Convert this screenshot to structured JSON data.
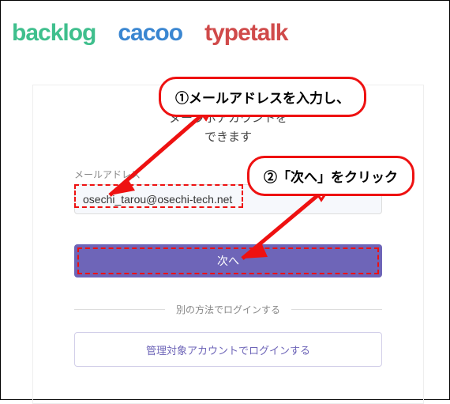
{
  "logos": {
    "backlog": "backlog",
    "cacoo": "cacoo",
    "typetalk": "typetalk"
  },
  "card": {
    "heading_line1": "ヌーラボアカウントを",
    "heading_line2": "できます",
    "field_label": "メールアドレス",
    "email_value": "osechi_tarou@osechi-tech.net",
    "next_label": "次へ",
    "divider_label": "別の方法でログインする",
    "alt_login_label": "管理対象アカウントでログインする"
  },
  "annotations": {
    "callout1": "①メールアドレスを入力し、",
    "callout2": "②「次へ」をクリック"
  }
}
